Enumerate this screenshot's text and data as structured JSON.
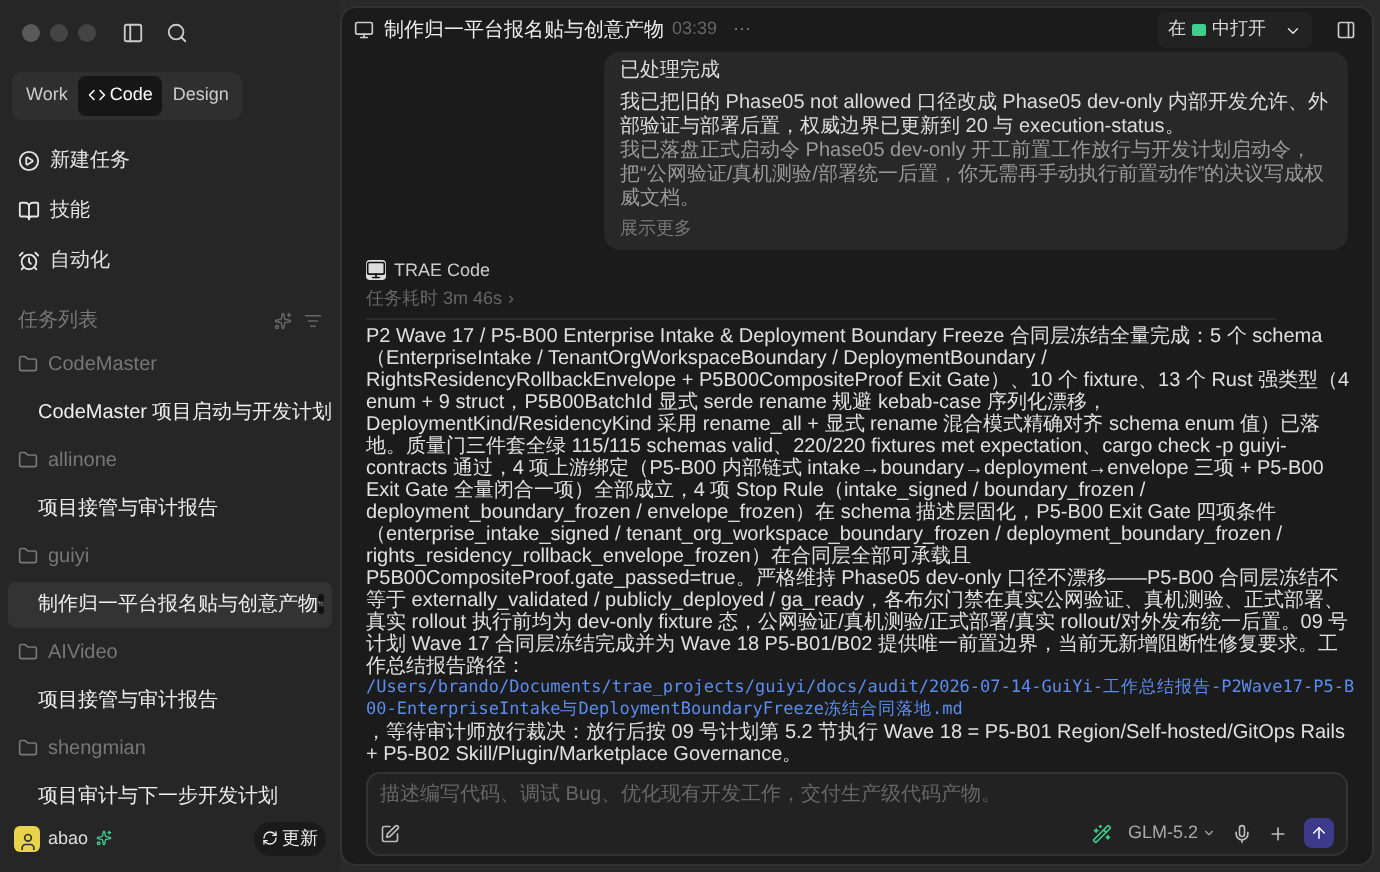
{
  "sidebar": {
    "modes": [
      {
        "label": "Work",
        "selected": false
      },
      {
        "label": "Code",
        "selected": true
      },
      {
        "label": "Design",
        "selected": false
      }
    ],
    "nav": [
      {
        "label": "新建任务",
        "kind": "new"
      },
      {
        "label": "技能",
        "kind": "skills"
      },
      {
        "label": "自动化",
        "kind": "automation"
      }
    ],
    "task_list_title": "任务列表",
    "groups": [
      {
        "name": "CodeMaster",
        "children": [
          {
            "title": "CodeMaster 项目启动与开发计划",
            "selected": false
          }
        ]
      },
      {
        "name": "allinone",
        "children": [
          {
            "title": "项目接管与审计报告",
            "selected": false
          }
        ]
      },
      {
        "name": "guiyi",
        "children": [
          {
            "title": "制作归一平台报名贴与创意产物",
            "selected": true
          }
        ]
      },
      {
        "name": "AIVideo",
        "children": [
          {
            "title": "项目接管与审计报告",
            "selected": false
          }
        ]
      },
      {
        "name": "shengmian",
        "children": [
          {
            "title": "项目审计与下一步开发计划",
            "selected": false
          }
        ]
      }
    ],
    "user": {
      "name": "abao"
    },
    "update_button": "更新"
  },
  "header": {
    "title": "制作归一平台报名贴与创意产物",
    "time": "03:39",
    "more": "···",
    "open_prefix": "在",
    "open_suffix": "中打开"
  },
  "user_message": {
    "paragraphs": [
      "已处理完成",
      "我已把旧的 Phase05 not allowed 口径改成 Phase05 dev-only 内部开发允许、外部验证与部署后置，权威边界已更新到 20 与 execution-status。",
      "我已落盘正式启动令 Phase05 dev-only 开工前置工作放行与开发计划启动令，把“公网验证/真机测验/部署统一后置，你无需再手动执行前置动作”的决议写成权威文档。"
    ],
    "show_more": "展示更多"
  },
  "reply": {
    "author": "TRAE Code",
    "duration": "任务耗时 3m 46s",
    "more": "›",
    "text_before": "P2 Wave 17 / P5-B00 Enterprise Intake & Deployment Boundary Freeze 合同层冻结全量完成：5 个 schema（EnterpriseIntake / TenantOrgWorkspaceBoundary / DeploymentBoundary / RightsResidencyRollbackEnvelope + P5B00CompositeProof Exit Gate）、10 个 fixture、13 个 Rust 强类型（4 enum + 9 struct，P5B00BatchId 显式 serde rename 规避 kebab-case 序列化漂移，DeploymentKind/ResidencyKind 采用 rename_all + 显式 rename 混合模式精确对齐 schema enum 值）已落地。质量门三件套全绿 115/115 schemas valid、220/220 fixtures met expectation、cargo check -p guiyi-contracts 通过，4 项上游绑定（P5-B00 内部链式 intake→boundary→deployment→envelope 三项 + P5-B00 Exit Gate 全量闭合一项）全部成立，4 项 Stop Rule（intake_signed / boundary_frozen / deployment_boundary_frozen / envelope_frozen）在 schema 描述层固化，P5-B00 Exit Gate 四项条件（enterprise_intake_signed / tenant_org_workspace_boundary_frozen / deployment_boundary_frozen / rights_residency_rollback_envelope_frozen）在合同层全部可承载且 P5B00CompositeProof.gate_passed=true。严格维持 Phase05 dev-only 口径不漂移——P5-B00 合同层冻结不等于 externally_validated / publicly_deployed / ga_ready，各布尔门禁在真实公网验证、真机测验、正式部署、真实 rollout 执行前均为 dev-only fixture 态，公网验证/真机测验/正式部署/真实 rollout/对外发布统一后置。09 号计划 Wave 17 合同层冻结完成并为 Wave 18 P5-B01/B02 提供唯一前置边界，当前无新增阻断性修复要求。工作总结报告路径：",
    "link": "/Users/brando/Documents/trae_projects/guiyi/docs/audit/2026-07-14-GuiYi-工作总结报告-P2Wave17-P5-B00-EnterpriseIntake与DeploymentBoundaryFreeze冻结合同落地.md",
    "text_after": "，等待审计师放行裁决：放行后按 09 号计划第 5.2 节执行 Wave 18 = P5-B01 Region/Self-hosted/GitOps Rails + P5-B02 Skill/Plugin/Marketplace Governance。"
  },
  "composer": {
    "placeholder": "描述编写代码、调试 Bug、优化现有开发工作，交付生产级代码产物。",
    "model": "GLM-5.2"
  }
}
